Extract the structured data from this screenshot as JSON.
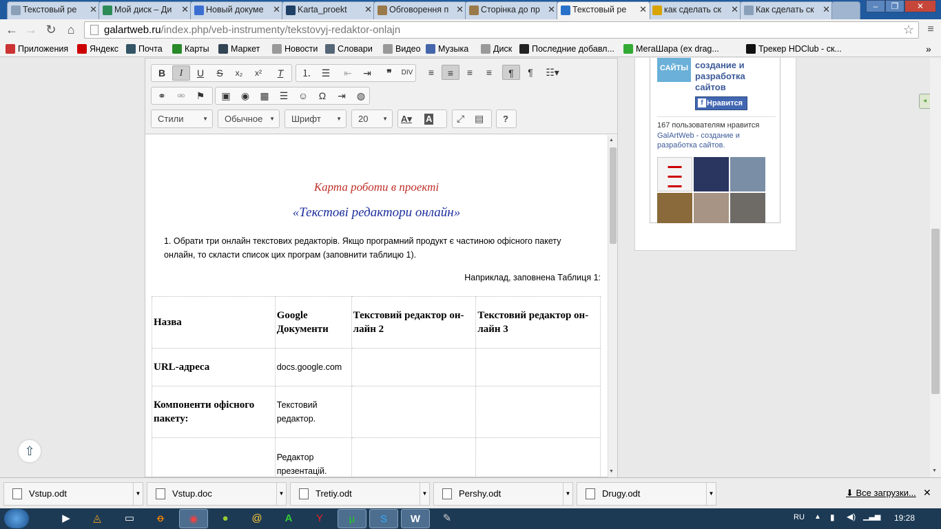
{
  "browser": {
    "tabs": [
      {
        "title": "Текстовый ре",
        "icon": "page-icon",
        "color": "#8aa0b8"
      },
      {
        "title": "Мой диск – Ди",
        "icon": "drive-icon",
        "color": "#2e8b57"
      },
      {
        "title": "Новый докуме",
        "icon": "docs-icon",
        "color": "#3a6fd1"
      },
      {
        "title": "Karta_proekt",
        "icon": "skype-icon",
        "color": "#1e3f66"
      },
      {
        "title": "Обговорення п",
        "icon": "gear-icon",
        "color": "#9a7a4a"
      },
      {
        "title": "Сторінка до пр",
        "icon": "gear-icon",
        "color": "#9a7a4a"
      },
      {
        "title": "Текстовый ре",
        "icon": "globe-icon",
        "color": "#2a72c9"
      },
      {
        "title": "как сделать ск",
        "icon": "search-icon",
        "color": "#d8a400"
      },
      {
        "title": "Как сделать ск",
        "icon": "page-icon",
        "color": "#8aa0b8"
      }
    ],
    "url_host": "galartweb.ru",
    "url_path": "/index.php/veb-instrumenty/tekstovyj-redaktor-onlajn",
    "bookmarks": [
      {
        "label": "Приложения",
        "icon": "apps-icon",
        "color": "#c33"
      },
      {
        "label": "Яндекс",
        "icon": "yandex-icon",
        "color": "#c00"
      },
      {
        "label": "Почта",
        "icon": "mail-icon",
        "color": "#356"
      },
      {
        "label": "Карты",
        "icon": "maps-icon",
        "color": "#2a8a2a"
      },
      {
        "label": "Маркет",
        "icon": "market-icon",
        "color": "#345"
      },
      {
        "label": "Новости",
        "icon": "page-icon",
        "color": "#999"
      },
      {
        "label": "Словари",
        "icon": "dict-icon",
        "color": "#567"
      },
      {
        "label": "Видео",
        "icon": "page-icon",
        "color": "#999"
      },
      {
        "label": "Музыка",
        "icon": "music-icon",
        "color": "#46a"
      },
      {
        "label": "Диск",
        "icon": "page-icon",
        "color": "#999"
      },
      {
        "label": "Последние добавл...",
        "icon": "film-icon",
        "color": "#222"
      },
      {
        "label": "МегаШара (ex drag...",
        "icon": "check-icon",
        "color": "#3a3"
      },
      {
        "label": "",
        "icon": "page-icon",
        "color": "#999"
      },
      {
        "label": "Трекер HDClub - ск...",
        "icon": "hd-icon",
        "color": "#111"
      }
    ]
  },
  "editor": {
    "combos": {
      "styles": "Стили",
      "format": "Обычное",
      "font": "Шрифт",
      "size": "20"
    },
    "title1": "Карта роботи в проекті",
    "title2": "«Текстові редактори онлайн»",
    "para1": "1. Обрати три онлайн текстових редакторів. Якщо програмний продукт є частиною офісного пакету онлайн, то скласти список цих програм (заповнити таблицю 1).",
    "para2": "Наприклад, заповнена Таблиця 1:",
    "table": {
      "headers": [
        "Назва",
        "Google Документи",
        "Текстовий редактор он-лайн 2",
        "Текстовий редактор он-лайн 3"
      ],
      "rows": [
        [
          "URL-адреса",
          "docs.google.com",
          "",
          ""
        ],
        [
          "Компоненти офісного пакету:",
          "Текстовий редактор.",
          "",
          ""
        ],
        [
          "",
          "Редактор презентацій.",
          "",
          ""
        ]
      ]
    }
  },
  "sidebar": {
    "page_name": "создание и разработка сайтов",
    "like_button": "Нравится",
    "like_text": "167 пользователям нравится",
    "like_link": "GalArtWeb - создание и разработка сайтов.",
    "logo_text": "САЙТЫ"
  },
  "downloads": {
    "files": [
      "Vstup.odt",
      "Vstup.doc",
      "Tretiy.odt",
      "Pershy.odt",
      "Drugy.odt"
    ],
    "all_link": "Все загрузки..."
  },
  "taskbar": {
    "lang": "RU",
    "time": "19:28"
  }
}
